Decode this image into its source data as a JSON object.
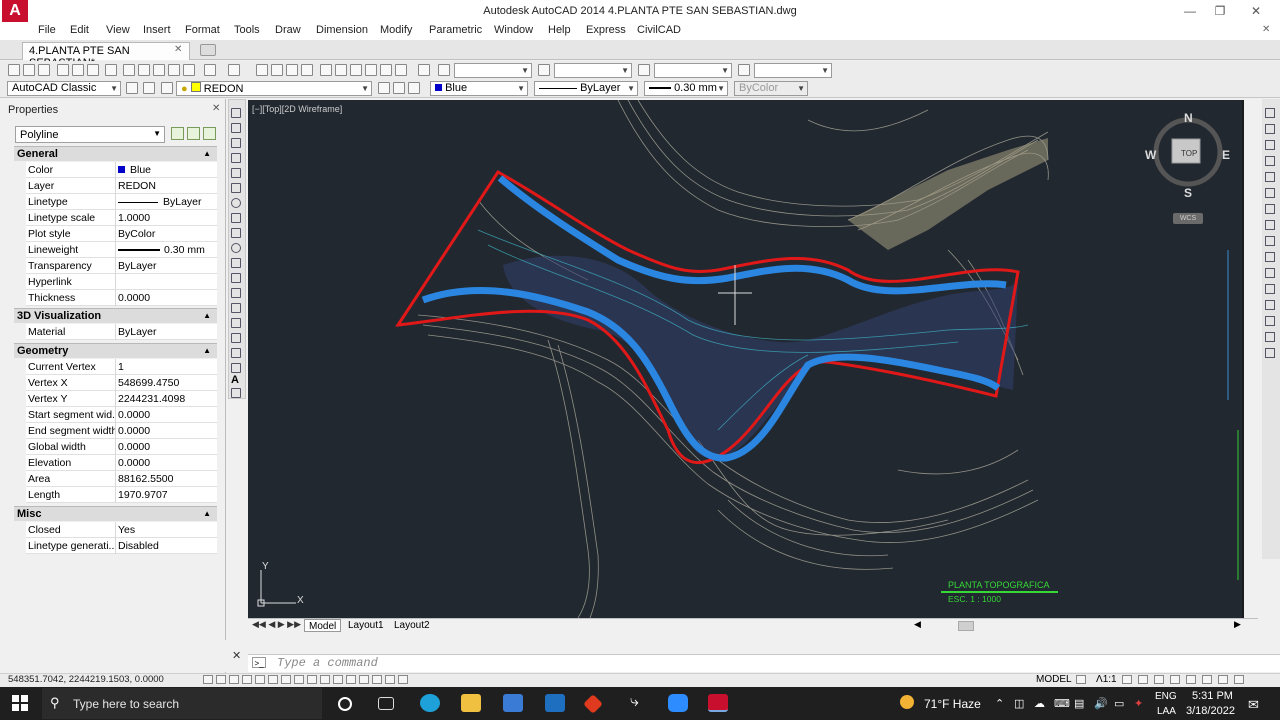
{
  "window": {
    "title": "Autodesk AutoCAD 2014    4.PLANTA PTE SAN SEBASTIAN.dwg",
    "logo": "A"
  },
  "menu": [
    "File",
    "Edit",
    "View",
    "Insert",
    "Format",
    "Tools",
    "Draw",
    "Dimension",
    "Modify",
    "Parametric",
    "Window",
    "Help",
    "Express",
    "CivilCAD"
  ],
  "document_tab": "4.PLANTA PTE SAN SEBASTIAN*",
  "toolbar": {
    "workspace": "AutoCAD Classic",
    "layer": "REDON",
    "color": "Blue",
    "linetype": "ByLayer",
    "lineweight": "0.30 mm",
    "plotstyle": "ByColor"
  },
  "properties": {
    "title": "Properties",
    "object_type": "Polyline",
    "sections": {
      "general": {
        "label": "General",
        "rows": [
          {
            "name": "Color",
            "value": "Blue"
          },
          {
            "name": "Layer",
            "value": "REDON"
          },
          {
            "name": "Linetype",
            "value": "ByLayer"
          },
          {
            "name": "Linetype scale",
            "value": "1.0000"
          },
          {
            "name": "Plot style",
            "value": "ByColor"
          },
          {
            "name": "Lineweight",
            "value": "0.30 mm"
          },
          {
            "name": "Transparency",
            "value": "ByLayer"
          },
          {
            "name": "Hyperlink",
            "value": ""
          },
          {
            "name": "Thickness",
            "value": "0.0000"
          }
        ]
      },
      "viz": {
        "label": "3D Visualization",
        "rows": [
          {
            "name": "Material",
            "value": "ByLayer"
          }
        ]
      },
      "geometry": {
        "label": "Geometry",
        "rows": [
          {
            "name": "Current Vertex",
            "value": "1"
          },
          {
            "name": "Vertex X",
            "value": "548699.4750"
          },
          {
            "name": "Vertex Y",
            "value": "2244231.4098"
          },
          {
            "name": "Start segment wid...",
            "value": "0.0000"
          },
          {
            "name": "End segment width",
            "value": "0.0000"
          },
          {
            "name": "Global width",
            "value": "0.0000"
          },
          {
            "name": "Elevation",
            "value": "0.0000"
          },
          {
            "name": "Area",
            "value": "88162.5500"
          },
          {
            "name": "Length",
            "value": "1970.9707"
          }
        ]
      },
      "misc": {
        "label": "Misc",
        "rows": [
          {
            "name": "Closed",
            "value": "Yes"
          },
          {
            "name": "Linetype generati...",
            "value": "Disabled"
          }
        ]
      }
    }
  },
  "viewport": {
    "label": "[−][Top][2D Wireframe]",
    "title_block": {
      "title": "PLANTA TOPOGRAFICA",
      "scale": "ESC. 1 : 1000"
    },
    "ucs": {
      "x": "X",
      "y": "Y"
    }
  },
  "viewcube": {
    "n": "N",
    "s": "S",
    "e": "E",
    "w": "W",
    "face": "TOP",
    "wcs": "WCS"
  },
  "layout_tabs": [
    "Model",
    "Layout1",
    "Layout2"
  ],
  "command": {
    "placeholder": "Type a command"
  },
  "status": {
    "coords": "548351.7042, 2244219.1503, 0.0000",
    "space": "MODEL",
    "scale": "1:1"
  },
  "taskbar": {
    "search": "Type here to search",
    "weather": "71°F  Haze",
    "lang1": "ENG",
    "lang2": "LAA",
    "time": "5:31 PM",
    "date": "3/18/2022"
  },
  "colors": {
    "boundary": "#e01818",
    "channel": "#2a86e0",
    "drawing_bg": "#212830",
    "title_block": "#35d835"
  }
}
